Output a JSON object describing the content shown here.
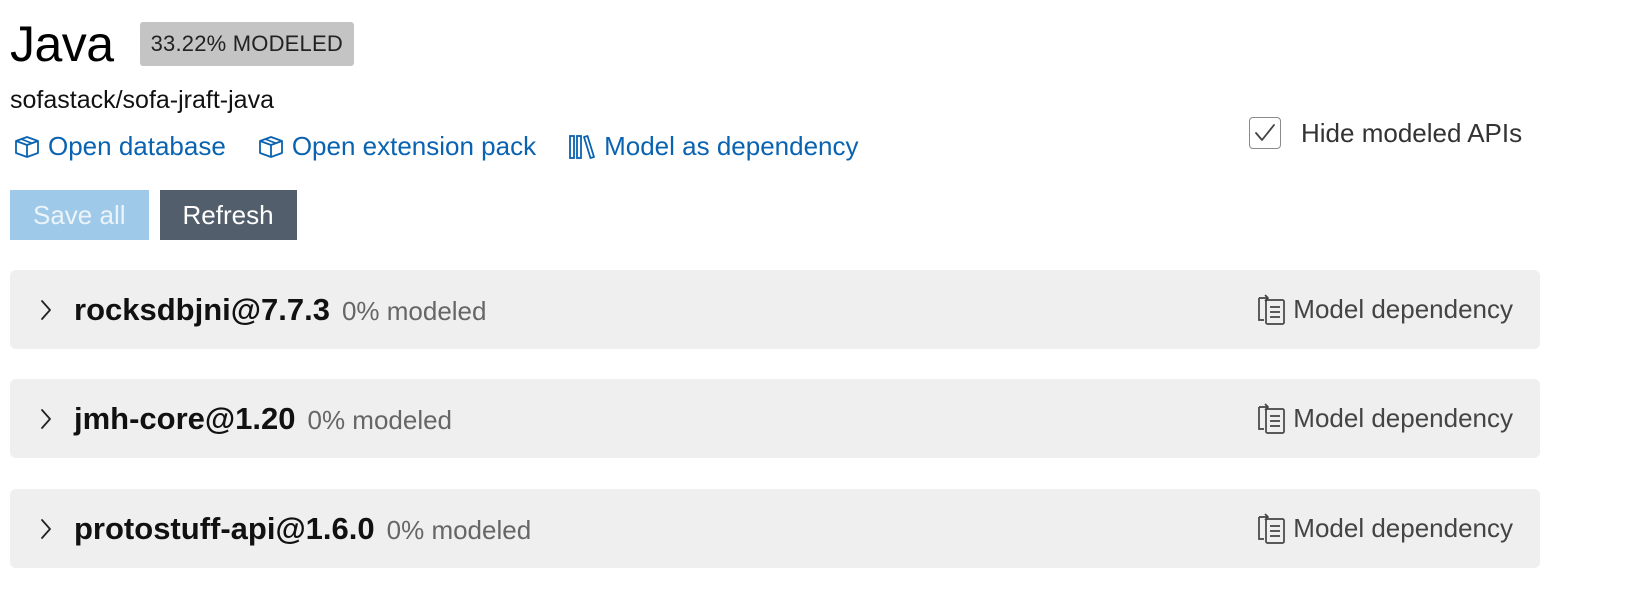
{
  "header": {
    "title": "Java",
    "badge": "33.22% MODELED",
    "repo": "sofastack/sofa-jraft-java"
  },
  "links": {
    "open_database": "Open database",
    "open_extension_pack": "Open extension pack",
    "model_as_dependency": "Model as dependency"
  },
  "hide_modeled": {
    "label": "Hide modeled APIs",
    "checked": true
  },
  "buttons": {
    "save_all": "Save all",
    "refresh": "Refresh"
  },
  "colors": {
    "link": "#0a63b0",
    "badge_bg": "#c4c4c4",
    "save_bg": "#9ec9e8",
    "refresh_bg": "#525e6b",
    "row_bg": "#efefef"
  },
  "dependencies": [
    {
      "name": "rocksdbjni@7.7.3",
      "modeled": "0% modeled",
      "action": "Model dependency"
    },
    {
      "name": "jmh-core@1.20",
      "modeled": "0% modeled",
      "action": "Model dependency"
    },
    {
      "name": "protostuff-api@1.6.0",
      "modeled": "0% modeled",
      "action": "Model dependency"
    }
  ]
}
